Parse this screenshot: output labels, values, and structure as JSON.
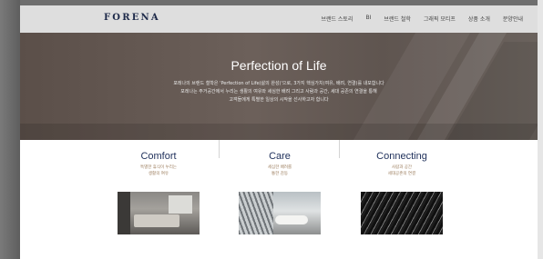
{
  "brand": {
    "logo": "FORENA"
  },
  "nav": {
    "items": [
      {
        "label": "브랜드 스토리"
      },
      {
        "label": "BI"
      },
      {
        "label": "브랜드 철학"
      },
      {
        "label": "그래픽 모티프"
      },
      {
        "label": "상품 소개"
      },
      {
        "label": "분양안내"
      }
    ]
  },
  "hero": {
    "title": "Perfection of Life",
    "lines": [
      "포레나의 브랜드 철학은 'Perfection of Life(삶의 완성)'으로, 3가지 핵심가치(여유, 배려, 연결)를 내포합니다",
      "포레나는 주거공간에서 누리는 생활의 여유와 세심한 배려 그리고 사람과 공간, 세대 공존의 연결을 통해",
      "고객들에게 특별한 일상의 시작을 선사하고자 합니다"
    ]
  },
  "features": [
    {
      "title": "Comfort",
      "desc": [
        "특별한 휴식이 누리는",
        "생활의 여유"
      ]
    },
    {
      "title": "Care",
      "desc": [
        "세심한 배려를",
        "통한 감동"
      ]
    },
    {
      "title": "Connecting",
      "desc": [
        "사람과 공간",
        "세대공존의 연결"
      ]
    }
  ]
}
